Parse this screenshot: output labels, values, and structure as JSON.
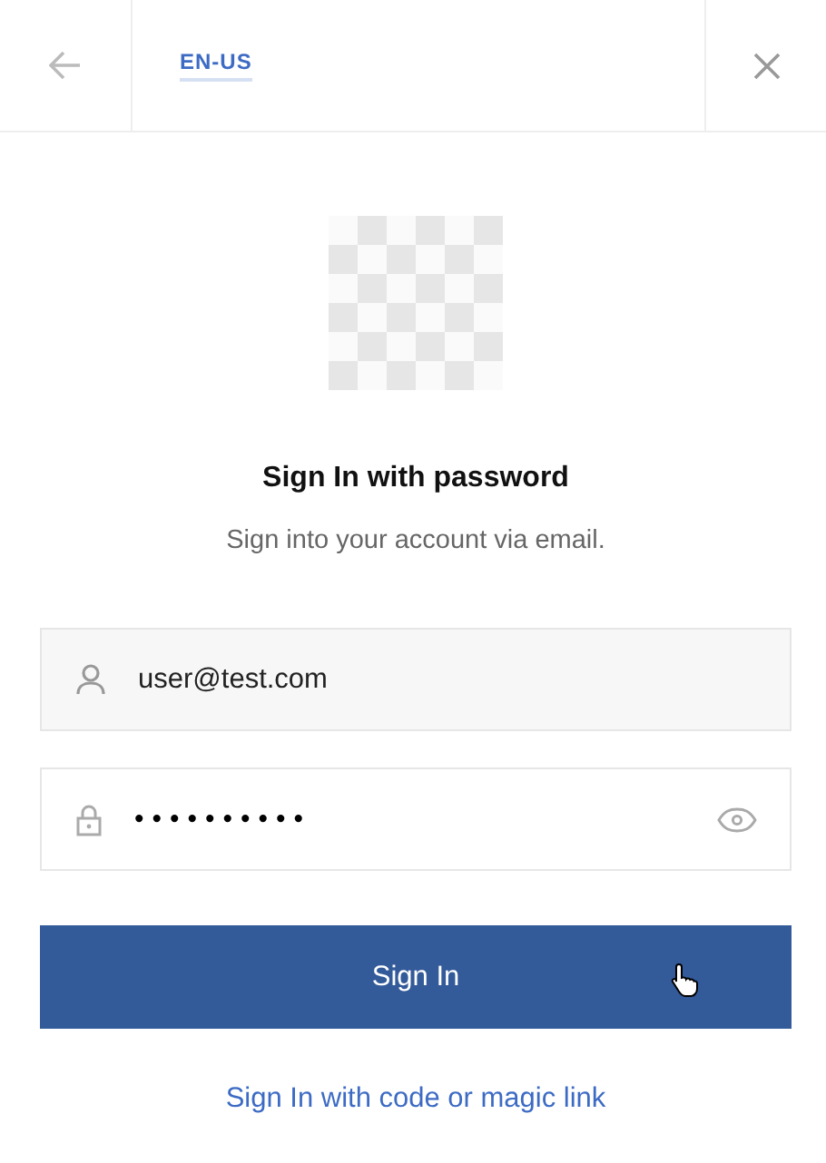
{
  "header": {
    "locale": "EN-US"
  },
  "title": "Sign In with password",
  "subtitle": "Sign into your account via email.",
  "fields": [
    {
      "kind": "email",
      "value": "user@test.com"
    },
    {
      "kind": "password",
      "value": "••••••••••"
    }
  ],
  "submit": "Sign In",
  "alt_link": "Sign In with code or magic link"
}
